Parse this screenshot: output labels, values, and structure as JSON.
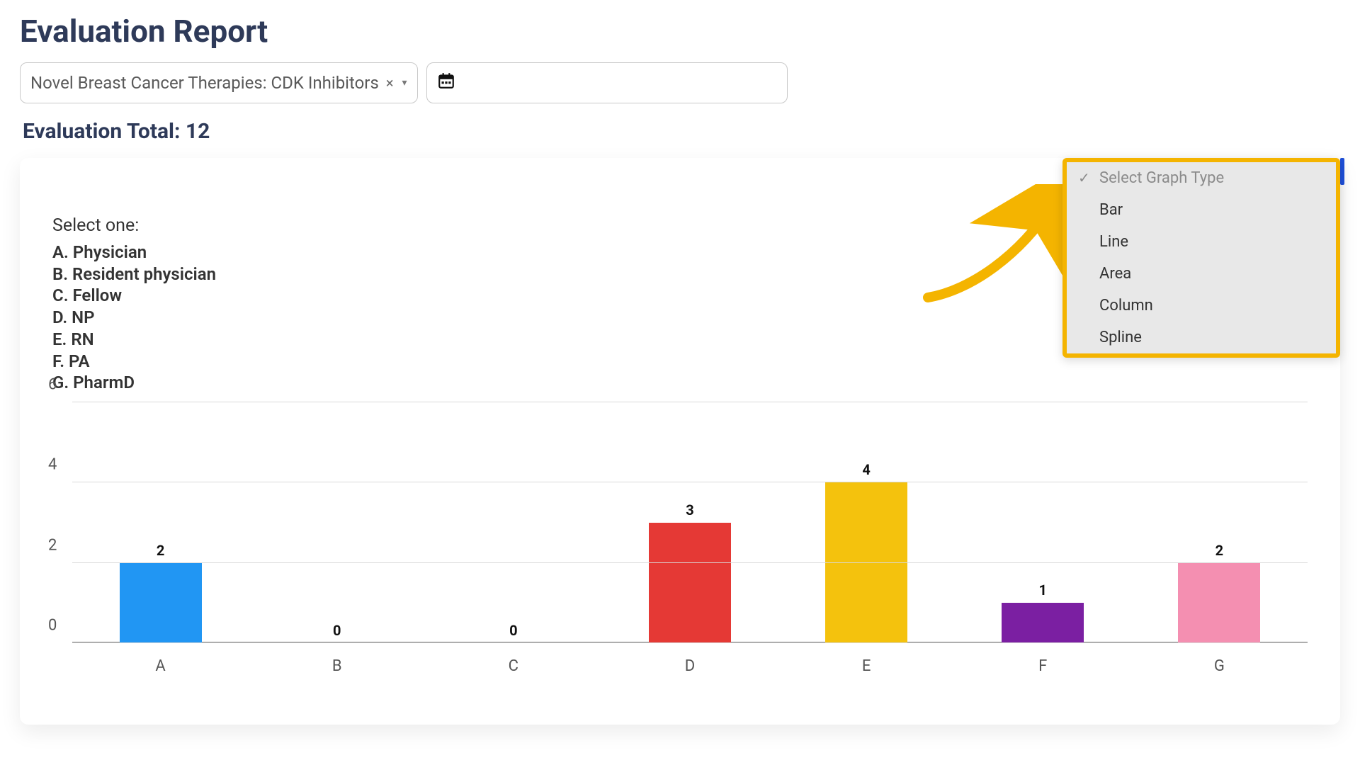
{
  "header": {
    "title": "Evaluation Report"
  },
  "controls": {
    "course": {
      "label": "Novel Breast Cancer Therapies: CDK Inhibitors",
      "clear_icon": "×",
      "caret_icon": "▾"
    },
    "date": {
      "icon": "calendar"
    }
  },
  "summary": {
    "total_label": "Evaluation Total: 12"
  },
  "legend": {
    "title": "Select one:",
    "items": [
      "A. Physician",
      "B. Resident physician",
      "C. Fellow",
      "D. NP",
      "E. RN",
      "F. PA",
      "G. PharmD"
    ]
  },
  "graph_type_menu": {
    "header": "Select Graph Type",
    "options": [
      "Bar",
      "Line",
      "Area",
      "Column",
      "Spline"
    ]
  },
  "chart_data": {
    "type": "bar",
    "title": "",
    "xlabel": "",
    "ylabel": "",
    "ylim": [
      0,
      6
    ],
    "yticks": [
      0,
      2,
      4,
      6
    ],
    "categories": [
      "A",
      "B",
      "C",
      "D",
      "E",
      "F",
      "G"
    ],
    "values": [
      2,
      0,
      0,
      3,
      4,
      1,
      2
    ],
    "colors": [
      "#2196f3",
      "#4caf50",
      "#ff9800",
      "#e53935",
      "#f4c20d",
      "#7b1fa2",
      "#f48fb1"
    ]
  }
}
